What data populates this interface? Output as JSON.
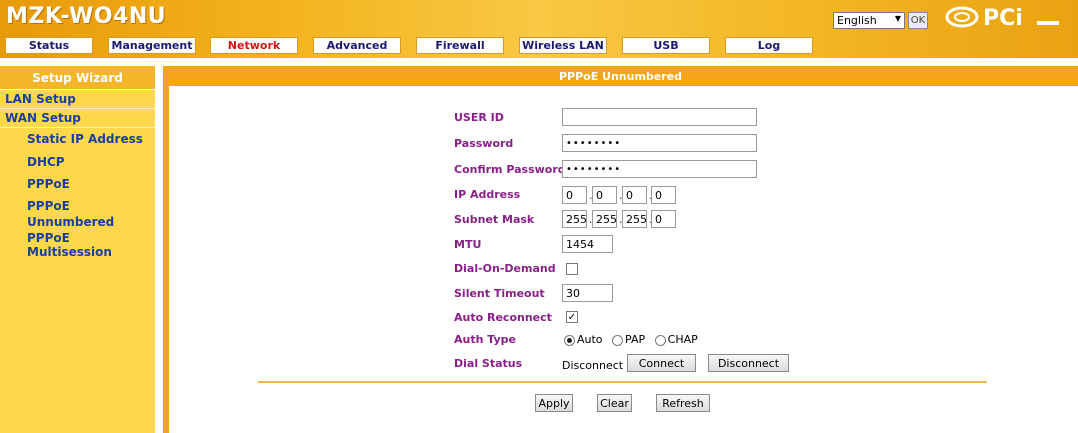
{
  "header": {
    "brand": "MZK-WO4NU",
    "language": "English",
    "ok_label": "OK",
    "logo_text": "PCi"
  },
  "nav": {
    "tabs": [
      {
        "label": "Status"
      },
      {
        "label": "Management"
      },
      {
        "label": "Network",
        "active": true
      },
      {
        "label": "Advanced"
      },
      {
        "label": "Firewall"
      },
      {
        "label": "Wireless LAN"
      },
      {
        "label": "USB"
      },
      {
        "label": "Log"
      }
    ]
  },
  "sidebar": {
    "title": "Setup Wizard",
    "items": [
      {
        "label": "LAN Setup"
      },
      {
        "label": "WAN Setup"
      }
    ],
    "sub_items": [
      {
        "label": "Static IP Address"
      },
      {
        "label": "DHCP"
      },
      {
        "label": "PPPoE"
      },
      {
        "label": "PPPoE Unnumbered"
      },
      {
        "label": "PPPoE Multisession"
      }
    ]
  },
  "form": {
    "title": "PPPoE Unnumbered",
    "user_id_label": "USER ID",
    "user_id_value": "",
    "password_label": "Password",
    "password_value": "••••••••",
    "confirm_label": "Confirm Password",
    "confirm_value": "••••••••",
    "ip_label": "IP Address",
    "ip_values": [
      "0",
      "0",
      "0",
      "0"
    ],
    "mask_label": "Subnet Mask",
    "mask_values": [
      "255",
      "255",
      "255",
      "0"
    ],
    "mtu_label": "MTU",
    "mtu_value": "1454",
    "dod_label": "Dial-On-Demand",
    "dod_checked": false,
    "silent_label": "Silent Timeout",
    "silent_value": "30",
    "auto_label": "Auto Reconnect",
    "auto_checked": true,
    "auth_label": "Auth Type",
    "auth_options": [
      "Auto",
      "PAP",
      "CHAP"
    ],
    "auth_selected": "Auto",
    "dial_label": "Dial Status",
    "dial_value": "Disconnect",
    "connect_label": "Connect",
    "disconnect_label": "Disconnect"
  },
  "footer_buttons": {
    "apply": "Apply",
    "clear": "Clear",
    "refresh": "Refresh"
  },
  "colors": {
    "accent": "#f4a417",
    "label": "#8a1f8a",
    "sidebar_text": "#1a3fa0",
    "active_tab": "#d11414"
  }
}
